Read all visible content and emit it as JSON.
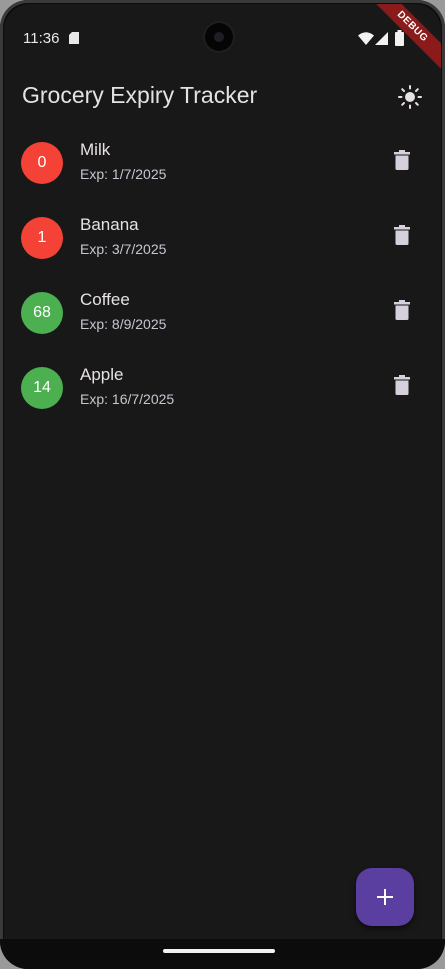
{
  "status_bar": {
    "time": "11:36",
    "icons": [
      "sd-card-icon",
      "wifi-icon",
      "signal-icon",
      "battery-icon"
    ]
  },
  "debug_banner": "DEBUG",
  "app_bar": {
    "title": "Grocery Expiry Tracker",
    "action_icon": "sun-icon"
  },
  "items": [
    {
      "days": "0",
      "name": "Milk",
      "expiry": "Exp: 1/7/2025",
      "color": "#f44336"
    },
    {
      "days": "1",
      "name": "Banana",
      "expiry": "Exp: 3/7/2025",
      "color": "#f44336"
    },
    {
      "days": "68",
      "name": "Coffee",
      "expiry": "Exp: 8/9/2025",
      "color": "#4caf50"
    },
    {
      "days": "14",
      "name": "Apple",
      "expiry": "Exp: 16/7/2025",
      "color": "#4caf50"
    }
  ],
  "fab": {
    "icon": "plus-icon"
  },
  "colors": {
    "background": "#181818",
    "fab": "#5a3ea0",
    "expired": "#f44336",
    "fresh": "#4caf50"
  }
}
